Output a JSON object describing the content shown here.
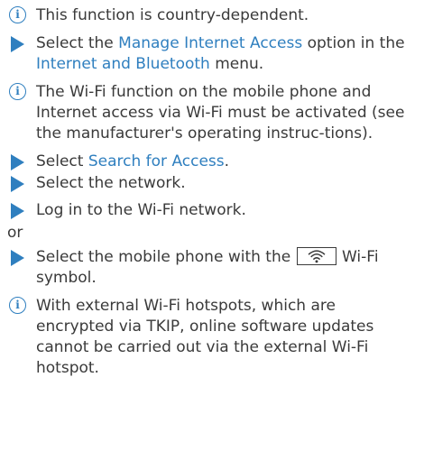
{
  "note1": "This function is country-dependent.",
  "step1": {
    "pre": "Select the ",
    "link1": "Manage Internet Access",
    "mid": " option in the ",
    "link2": "Internet and Bluetooth",
    "post": " menu."
  },
  "note2": "The Wi-Fi function on the mobile phone and Internet access via Wi-Fi must be activated (see the manufacturer's operating instruc-tions).",
  "step2": {
    "pre": "Select ",
    "link": "Search for Access",
    "post": "."
  },
  "step3": "Select the network.",
  "step4": "Log in to the Wi-Fi network.",
  "or_label": "or",
  "step5": {
    "pre": "Select the mobile phone with the ",
    "symbol_icon": "wifi-icon",
    "post": " Wi-Fi symbol."
  },
  "note3": "With external Wi-Fi hotspots, which are encrypted via TKIP, online software updates cannot be carried out via the external Wi-Fi hotspot.",
  "colors": {
    "accent": "#2f7fbf",
    "text": "#3a3a3a"
  },
  "icons": {
    "info": "info-icon",
    "step": "step-arrow-icon"
  }
}
